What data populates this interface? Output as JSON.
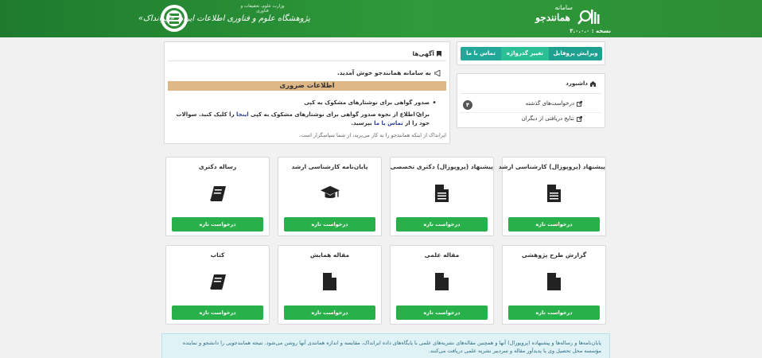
{
  "header": {
    "org_subtitle": "وزارت علوم، تحقیقات و فناوری",
    "org_title": "پژوهشگاه علوم و فناوری اطلاعات ایران «ایرانداک»",
    "system_label": "سامانه",
    "system_name": "همانندجو",
    "version": "نسخه : ۳.۰.۰.۰"
  },
  "tabs": {
    "edit_profile": "ویرایش پروفایل",
    "change_password": "تغییر گذرواژه",
    "contact_us": "تماس با ما"
  },
  "announcements": {
    "title": "آگهی‌ها",
    "welcome": "به سامانه همانندجو خوش آمدید.",
    "important_banner": "اطلاعات ضروری",
    "bullet_title": "صدور گواهی برای نوشتارهای مشکوک به کپی",
    "bullet_text_before": "برای اطلاع از نحوه صدور گواهی برای نوشتارهای مشکوک به کپی ",
    "bullet_link_here": "اینجا",
    "bullet_text_middle": " را کلیک کنید. سوالات خود را از ",
    "bullet_link_contact": "تماس با ما",
    "bullet_text_after": " بپرسید.",
    "footer": "ایرانداک از اینکه همانندجو را به کار می‌برید، از شما سپاسگزار است."
  },
  "dashboard": {
    "title": "داشبورد",
    "past_requests": "درخواست‌های گذشته",
    "past_requests_count": "۴",
    "received_results": "نتایج دریافتی از دیگران"
  },
  "cards": [
    {
      "title": "پیشنهاد (پروپوزال) کارشناسی ارشد",
      "icon": "file-icon",
      "button": "درخواست تازه"
    },
    {
      "title": "پیشنهاد (پروپوزال) دکتری تخصصی",
      "icon": "file-icon",
      "button": "درخواست تازه"
    },
    {
      "title": "پایان‌نامه کارشناسی ارشد",
      "icon": "graduation-cap-icon",
      "button": "درخواست تازه"
    },
    {
      "title": "رساله دکتری",
      "icon": "book-icon",
      "button": "درخواست تازه"
    },
    {
      "title": "گزارش طرح پژوهشی",
      "icon": "file-icon",
      "button": "درخواست تازه"
    },
    {
      "title": "مقاله علمی",
      "icon": "file-icon",
      "button": "درخواست تازه"
    },
    {
      "title": "مقاله همایش",
      "icon": "file-icon",
      "button": "درخواست تازه"
    },
    {
      "title": "کتاب",
      "icon": "book-icon",
      "button": "درخواست تازه"
    }
  ],
  "info_note": "پایان‌نامه‌ها و رساله‌ها و پیشنهاده (پروپوزال) آنها و همچنین مقاله‌های نشریه‌های علمی با پایگاه‌های داده ایرانداک، مقایسه و اندازه همانندی آنها روشن می‌شود. نتیجه همانندجویی را دانشجو و نماینده مؤسسه محل تحصیل وی یا پدیدآور مقاله و سردبیر نشریه علمی دریافت می‌کنند.",
  "colors": {
    "header_green": "#2d8d37",
    "tab_teal": "#1fa191",
    "button_green": "#28b04a",
    "banner_tan": "#deb887",
    "note_bg": "#dff3f6"
  }
}
